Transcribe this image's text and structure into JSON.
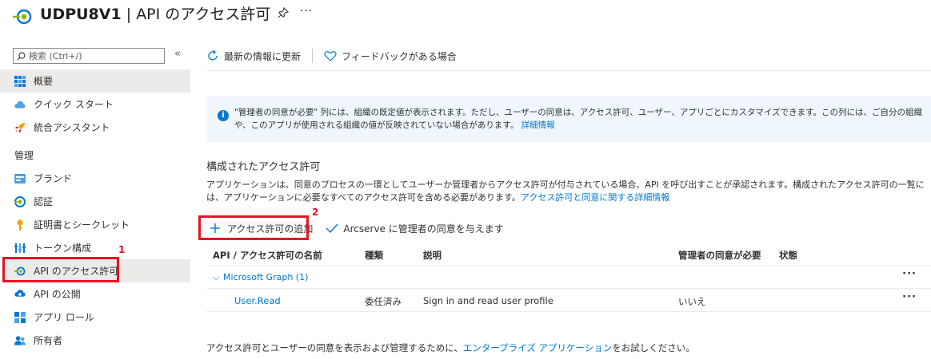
{
  "header": {
    "resource_name": "UDPU8V1",
    "separator": " | ",
    "page_name": "API のアクセス許可",
    "more": "···"
  },
  "sidebar": {
    "search_placeholder": "検索 (Ctrl+/)",
    "collapse": "«",
    "section_label": "管理",
    "items": [
      {
        "label": "概要",
        "icon": "overview-grid-icon"
      },
      {
        "label": "クイック スタート",
        "icon": "cloud-quickstart-icon"
      },
      {
        "label": "統合アシスタント",
        "icon": "rocket-icon"
      },
      {
        "label": "ブランド",
        "icon": "branding-icon"
      },
      {
        "label": "認証",
        "icon": "authentication-icon"
      },
      {
        "label": "証明書とシークレット",
        "icon": "key-icon"
      },
      {
        "label": "トークン構成",
        "icon": "token-bars-icon"
      },
      {
        "label": "API のアクセス許可",
        "icon": "api-permissions-icon"
      },
      {
        "label": "API の公開",
        "icon": "cloud-expose-icon"
      },
      {
        "label": "アプリ ロール",
        "icon": "app-roles-icon"
      },
      {
        "label": "所有者",
        "icon": "owners-icon"
      }
    ]
  },
  "toolbar": {
    "refresh_label": "最新の情報に更新",
    "feedback_label": "フィードバックがある場合"
  },
  "info": {
    "text": "\"管理者の同意が必要\" 列には、組織の既定値が表示されます。ただし、ユーザーの同意は、アクセス許可、ユーザー、アプリごとにカスタマイズできます。この列には、ご自分の組織や、このアプリが使用される組織の値が反映されていない場合があります。",
    "link": "詳細情報"
  },
  "configured": {
    "title": "構成されたアクセス許可",
    "desc": "アプリケーションは、同意のプロセスの一環としてユーザーか管理者からアクセス許可が付与されている場合、API を呼び出すことが承認されます。構成されたアクセス許可の一覧には、アプリケーションに必要なすべてのアクセス許可を含める必要があります。",
    "desc_link": "アクセス許可と同意に関する詳細情報"
  },
  "actions": {
    "add_label": "アクセス許可の追加",
    "grant_label": "Arcserve に管理者の同意を与えます"
  },
  "table": {
    "headers": {
      "name": "API / アクセス許可の名前",
      "type": "種類",
      "description": "説明",
      "admin_consent": "管理者の同意が必要",
      "status": "状態"
    },
    "group": "Microsoft Graph (1)",
    "rows": [
      {
        "name": "User.Read",
        "type": "委任済み",
        "description": "Sign in and read user profile",
        "admin_consent": "いいえ",
        "status": ""
      }
    ],
    "more": "···"
  },
  "footer": {
    "prefix": "アクセス許可とユーザーの同意を表示および管理するために、",
    "link": "エンタープライズ アプリケーション",
    "suffix": "をお試しください。"
  },
  "annotations": {
    "one": "1",
    "two": "2"
  },
  "colors": {
    "accent": "#0078d4",
    "annotation": "#e81123",
    "info_bg": "#eff6fc",
    "selected_bg": "#edebe9"
  }
}
